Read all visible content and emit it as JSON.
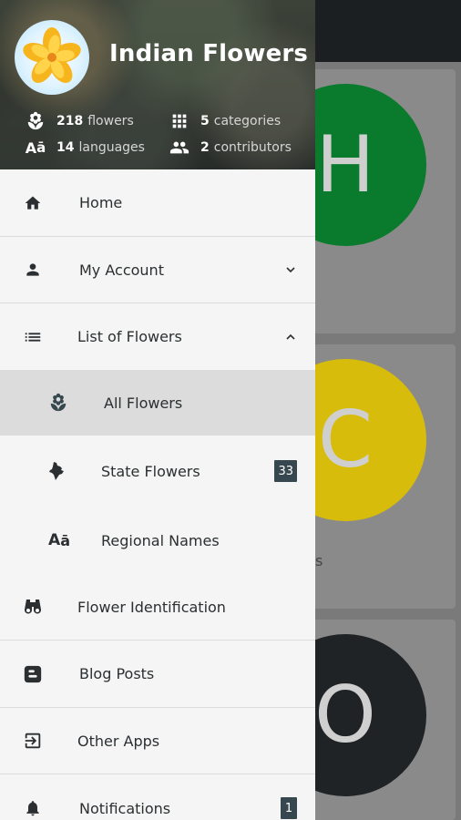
{
  "background": {
    "card_letters": [
      "H",
      "C",
      "O"
    ],
    "card_colors": [
      "#0a7a2c",
      "#d8bc0b",
      "#1f2325"
    ],
    "stray_text": "s"
  },
  "header": {
    "title": "Indian Flowers",
    "stats": {
      "flowers": {
        "count": "218",
        "unit": "flowers",
        "icon": "flower-icon"
      },
      "categories": {
        "count": "5",
        "unit": "categories",
        "icon": "grid-icon"
      },
      "languages": {
        "count": "14",
        "unit": "languages",
        "icon": "translate-icon"
      },
      "contributors": {
        "count": "2",
        "unit": "contributors",
        "icon": "people-icon"
      }
    }
  },
  "menu": {
    "home": {
      "label": "Home",
      "icon": "home-icon"
    },
    "my_account": {
      "label": "My Account",
      "icon": "person-icon",
      "expanded": false
    },
    "list_of_flowers": {
      "label": "List of Flowers",
      "icon": "list-icon",
      "expanded": true
    },
    "all_flowers": {
      "label": "All Flowers",
      "icon": "flower-icon",
      "selected": true
    },
    "state_flowers": {
      "label": "State Flowers",
      "icon": "india-map-icon",
      "badge": "33"
    },
    "regional_names": {
      "label": "Regional Names",
      "icon": "translate-icon"
    },
    "flower_identification": {
      "label": "Flower Identification",
      "icon": "binoculars-icon"
    },
    "blog_posts": {
      "label": "Blog Posts",
      "icon": "blogger-icon"
    },
    "other_apps": {
      "label": "Other Apps",
      "icon": "exit-to-app-icon"
    },
    "notifications": {
      "label": "Notifications",
      "icon": "bell-icon",
      "badge": "1"
    }
  },
  "colors": {
    "drawer_bg": "#f5f5f5",
    "selected_bg": "#dcdcdc",
    "badge_bg": "#37474f",
    "icon": "#2b2f31"
  }
}
